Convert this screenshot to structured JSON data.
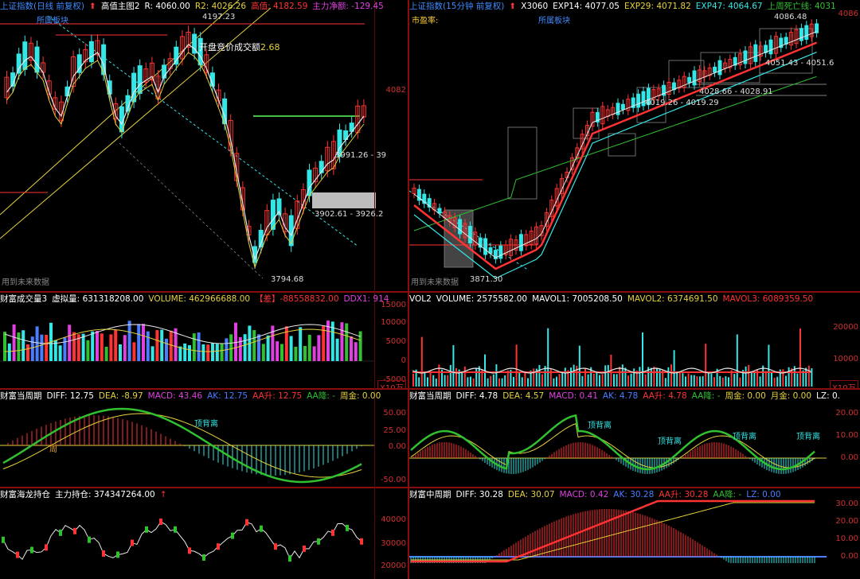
{
  "colors": {
    "up": "#ff3333",
    "down": "#35e6e6",
    "axis": "#d23030",
    "white": "#e8e8e8",
    "yellow": "#e6d23c",
    "green": "#30c030",
    "magenta": "#e040e0",
    "blue": "#4a7dff"
  },
  "left_main": {
    "title": "上证指数(日线 前复权)",
    "indicator": "高值主图2",
    "r": "R: 4060.00",
    "r2": "R2: 4026.26",
    "high_value": "高值: 4182.59",
    "main_net": "主力净额: -129.45",
    "sector": "所属板块",
    "annotation": "开盘竞价成交额",
    "annotation_value": "2.68",
    "high_label": "4197.23",
    "low_label": "3794.68",
    "range1": "3991.26 - 39",
    "range2": "3902.61 - 3926.2",
    "future": "用到未来数据",
    "ytick": "4082"
  },
  "right_main": {
    "title": "上证指数(15分钟 前复权)",
    "x": "X3060",
    "exp14": "EXP14: 4077.05",
    "exp29": "EXP29: 4071.82",
    "exp47": "EXP47: 4064.67",
    "weekly": "上周死亡线: 4031",
    "pe": "市盈率:",
    "sector": "所属板块",
    "high_label": "4086.48",
    "range1": "4051.43 - 4051.6",
    "range2": "4028.66 - 4028.91",
    "range3": "4019.26 - 4019.29",
    "low_label": "3871.30",
    "future": "用到未来数据",
    "ytick": "4086"
  },
  "left_vol": {
    "title": "财富成交量3",
    "virtual": "虚拟量: 631318208.00",
    "volume": "VOLUME: 462966688.00",
    "diff": "【差】-88558832.00",
    "ddx": "DDX1: 914",
    "ticks": [
      "15000",
      "10000",
      "5000",
      "0",
      "-5000"
    ],
    "unit": "X10万"
  },
  "right_vol": {
    "title": "VOL2",
    "volume": "VOLUME: 2575582.00",
    "mavol1": "MAVOL1: 7005208.50",
    "mavol2": "MAVOL2: 6374691.50",
    "mavol3": "MAVOL3: 6089359.50",
    "ticks": [
      "20000",
      "10000"
    ],
    "unit": "X10万"
  },
  "left_macd": {
    "title": "财富当周期",
    "diff": "DIFF: 12.75",
    "dea": "DEA: -8.97",
    "macd": "MACD: 43.46",
    "ak": "AK: 12.75",
    "aa_up": "AA升: 12.75",
    "aa_down": "AA降: -",
    "week_gold": "周金: 0.00",
    "top_div": "顶背离",
    "zhou": "周",
    "ticks": [
      "50.00",
      "25.00",
      "0.00",
      "-50.00"
    ]
  },
  "right_macd": {
    "title": "财富当周期",
    "diff": "DIFF: 4.78",
    "dea": "DEA: 4.57",
    "macd": "MACD: 0.41",
    "ak": "AK: 4.78",
    "aa_up": "AA升: 4.78",
    "aa_down": "AA降: -",
    "week_gold": "周金: 0.00",
    "month_gold": "月金: 0.00",
    "lz": "LZ: 0.",
    "top_div": [
      "顶背离",
      "顶背离",
      "顶背离",
      "顶背离"
    ],
    "ticks": [
      "20.00",
      "10.00",
      "0.00"
    ]
  },
  "left_hold": {
    "title": "财富海龙持仓",
    "hold": "主力持仓: 374347264.00",
    "ticks": [
      "40000",
      "30000",
      "20000"
    ]
  },
  "right_mid": {
    "title": "财富中周期",
    "diff": "DIFF: 30.28",
    "dea": "DEA: 30.07",
    "macd": "MACD: 0.42",
    "ak": "AK: 30.28",
    "aa_up": "AA升: 30.28",
    "aa_down": "AA降: -",
    "lz": "LZ: 0.00",
    "ticks": [
      "30.00",
      "20.00",
      "10.00",
      "0.00"
    ]
  }
}
